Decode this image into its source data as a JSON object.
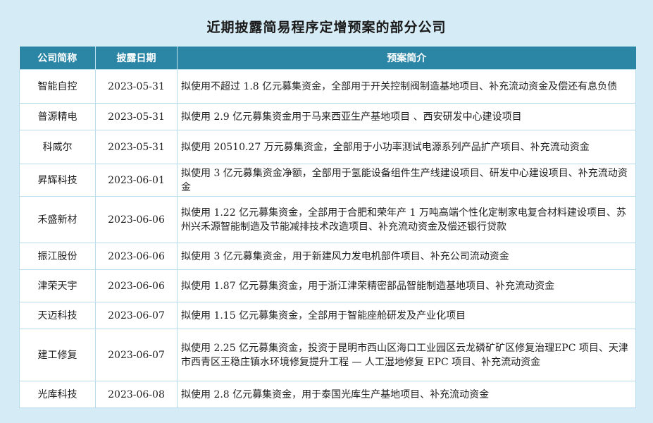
{
  "title": "近期披露简易程序定增预案的部分公司",
  "table": {
    "headers": [
      "公司简称",
      "披露日期",
      "预案简介"
    ],
    "rows": [
      {
        "name": "智能自控",
        "date": "2023-05-31",
        "desc": "拟使用不超过 1.8 亿元募集资金，全部用于开关控制阀制造基地项目、补充流动资金及偿还有息负债",
        "height": 48
      },
      {
        "name": "普源精电",
        "date": "2023-05-31",
        "desc": "拟使用 2.9 亿元募集资金用于马来西亚生产基地项目 、西安研发中心建设项目",
        "height": 38
      },
      {
        "name": "科威尔",
        "date": "2023-05-31",
        "desc": "拟使用 20510.27 万元募集资金，全部用于小功率测试电源系列产品扩产项目、补充流动资金",
        "height": 48
      },
      {
        "name": "昇辉科技",
        "date": "2023-06-01",
        "desc": "拟使用 3 亿元募集资金净额，全部用于氢能设备组件生产线建设项目、研发中心建设项目、补充流动资金",
        "height": 46
      },
      {
        "name": "禾盛新材",
        "date": "2023-06-06",
        "desc": "拟使用 1.22 亿元募集资金，全部用于合肥和荣年产 1 万吨高端个性化定制家电复合材料建设项目、苏州兴禾源智能制造及节能减排技术改造项目、补充流动资金及偿还银行贷款",
        "height": 66
      },
      {
        "name": "振江股份",
        "date": "2023-06-06",
        "desc": "拟使用 3 亿元募集资金，用于新建风力发电机部件项目、补充公司流动资金",
        "height": 38
      },
      {
        "name": "津荣天宇",
        "date": "2023-06-06",
        "desc": "拟使用 1.87 亿元募集资金，用于浙江津荣精密部品智能制造基地项目、补充流动资金",
        "height": 46
      },
      {
        "name": "天迈科技",
        "date": "2023-06-07",
        "desc": "拟使用 1.15 亿元募集资金，全部用于智能座舱研发及产业化项目",
        "height": 38
      },
      {
        "name": "建工修复",
        "date": "2023-06-07",
        "desc": "拟使用 2.25 亿元募集资金，投资于昆明市西山区海口工业园区云龙磷矿矿区修复治理EPC 项目、天津市西青区王稳庄镇水环境修复提升工程 — 人工湿地修复 EPC 项目、补充流动资金",
        "height": 74
      },
      {
        "name": "光库科技",
        "date": "2023-06-08",
        "desc": "拟使用 2.8 亿元募集资金，用于泰国光库生产基地项目、补充流动资金",
        "height": 38
      }
    ]
  }
}
